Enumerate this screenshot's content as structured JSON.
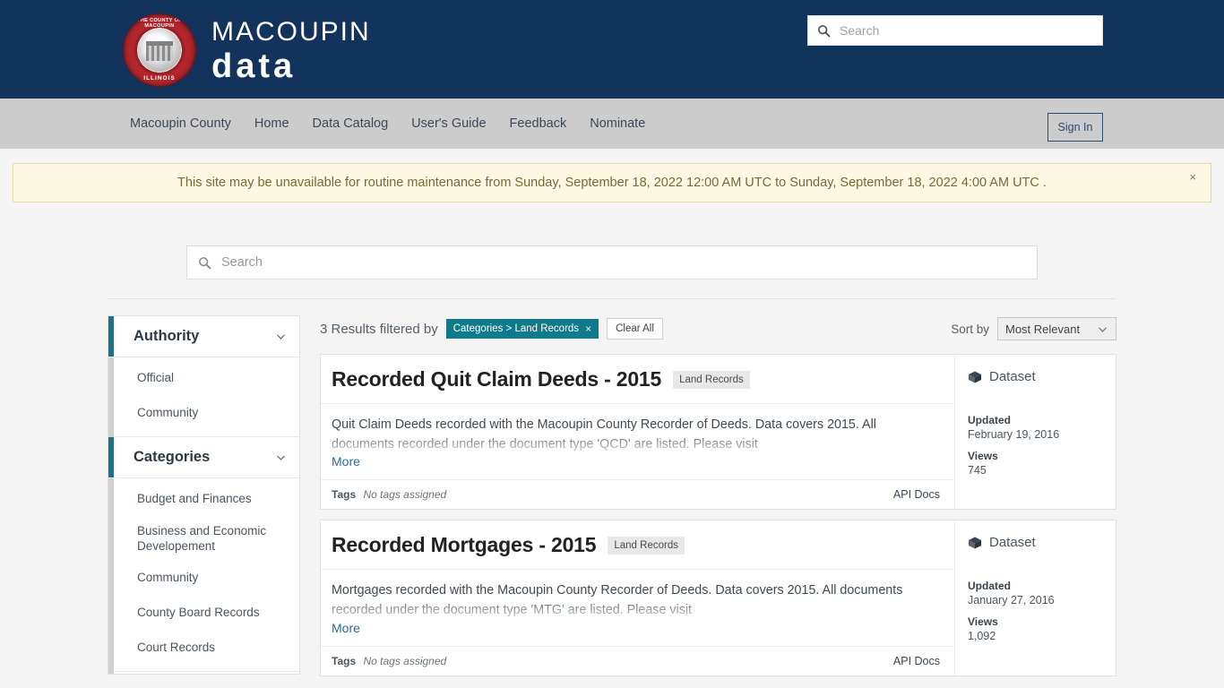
{
  "header": {
    "logo": {
      "seal_top_text": "THE COUNTY OF MACOUPIN",
      "seal_bottom_text": "ILLINOIS",
      "line1": "MACOUPIN",
      "line2": "data"
    },
    "search": {
      "placeholder": "Search",
      "value": "",
      "icon": "search-icon"
    },
    "background_color": "#11335c"
  },
  "nav": {
    "items": [
      {
        "label": "Macoupin County"
      },
      {
        "label": "Home"
      },
      {
        "label": "Data Catalog"
      },
      {
        "label": "User's Guide"
      },
      {
        "label": "Feedback"
      },
      {
        "label": "Nominate"
      }
    ],
    "sign_in_label": "Sign In",
    "background_color": "#cccccc"
  },
  "banner": {
    "text": "This site may be unavailable for routine maintenance from  Sunday, September 18, 2022 12:00 AM UTC  to  Sunday, September 18, 2022 4:00 AM UTC .",
    "close_label": "×",
    "background_color": "#fcf8e3"
  },
  "main_search": {
    "placeholder": "Search",
    "value": "",
    "icon": "search-icon"
  },
  "facets": [
    {
      "title": "Authority",
      "chevron": "chevron-down-icon",
      "items": [
        {
          "label": "Official"
        },
        {
          "label": "Community"
        }
      ]
    },
    {
      "title": "Categories",
      "chevron": "chevron-down-icon",
      "items": [
        {
          "label": "Budget and Finances"
        },
        {
          "label": "Business and Economic Developement"
        },
        {
          "label": "Community"
        },
        {
          "label": "County Board Records"
        },
        {
          "label": "Court Records"
        }
      ]
    }
  ],
  "results_bar": {
    "count_text": "3 Results filtered by",
    "chip_label": "Categories > Land Records",
    "chip_close": "×",
    "clear_all_label": "Clear All",
    "sort_label": "Sort by",
    "sort_value": "Most Relevant",
    "sort_chevron": "chevron-down-icon",
    "chip_color": "#0f7b8a"
  },
  "results": [
    {
      "title": "Recorded Quit Claim Deeds - 2015",
      "category_tag": "Land Records",
      "type_label": "Dataset",
      "type_icon": "cube-icon",
      "description": "Quit Claim Deeds recorded with the Macoupin County Recorder of Deeds. Data covers 2015. All documents recorded under the document type 'QCD' are listed. Please visit",
      "more_label": "More",
      "tags_label": "Tags",
      "tags_value": "No tags assigned",
      "api_docs_label": "API Docs",
      "updated_label": "Updated",
      "updated_value": "February 19, 2016",
      "views_label": "Views",
      "views_value": "745"
    },
    {
      "title": "Recorded Mortgages - 2015",
      "category_tag": "Land Records",
      "type_label": "Dataset",
      "type_icon": "cube-icon",
      "description": "Mortgages recorded with the Macoupin County Recorder of Deeds. Data covers 2015. All documents recorded under the document type 'MTG' are listed. Please visit",
      "more_label": "More",
      "tags_label": "Tags",
      "tags_value": "No tags assigned",
      "api_docs_label": "API Docs",
      "updated_label": "Updated",
      "updated_value": "January 27, 2016",
      "views_label": "Views",
      "views_value": "1,092"
    }
  ]
}
